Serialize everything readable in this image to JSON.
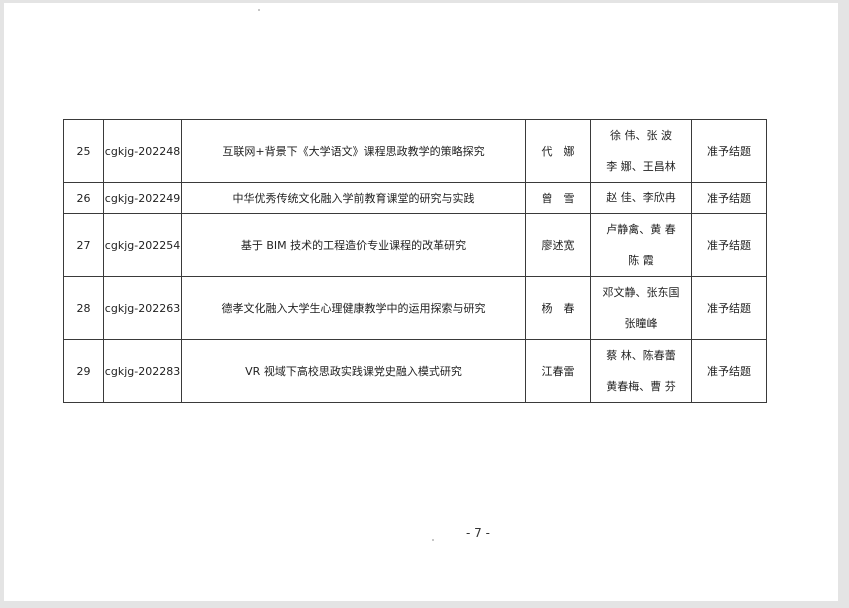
{
  "rows": [
    {
      "no": "25",
      "code": "cgkjg-202248",
      "title": "互联网+背景下《大学语文》课程思政教学的策略探究",
      "leader": "代　娜",
      "members": [
        "徐 伟、张 波",
        "李 娜、王昌林"
      ],
      "result": "准予结题"
    },
    {
      "no": "26",
      "code": "cgkjg-202249",
      "title": "中华优秀传统文化融入学前教育课堂的研究与实践",
      "leader": "曾　雪",
      "members": [
        "赵 佳、李欣冉"
      ],
      "result": "准予结题"
    },
    {
      "no": "27",
      "code": "cgkjg-202254",
      "title": "基于 BIM 技术的工程造价专业课程的改革研究",
      "leader": "廖述宽",
      "members": [
        "卢静禽、黄 春",
        "陈 霞"
      ],
      "result": "准予结题"
    },
    {
      "no": "28",
      "code": "cgkjg-202263",
      "title": "德孝文化融入大学生心理健康教学中的运用探索与研究",
      "leader": "杨　春",
      "members": [
        "邓文静、张东国",
        "张瞳峰"
      ],
      "result": "准予结题"
    },
    {
      "no": "29",
      "code": "cgkjg-202283",
      "title": "VR 视域下高校思政实践课党史融入模式研究",
      "leader": "江春雷",
      "members": [
        "蔡 林、陈春蕾",
        "黄春梅、曹 芬"
      ],
      "result": "准予结题"
    }
  ],
  "page_number": "- 7 -"
}
